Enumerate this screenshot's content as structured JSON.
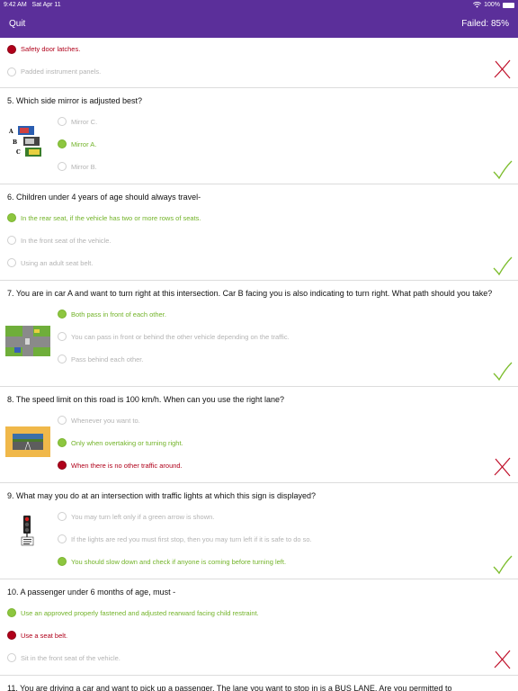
{
  "status": {
    "time": "9:42 AM",
    "date": "Sat Apr 11",
    "battery": "100%"
  },
  "nav": {
    "quit_label": "Quit",
    "result_label": "Failed: 85%"
  },
  "colors": {
    "header": "#5b2f9a",
    "correct": "#8dc63f",
    "wrong": "#b0001a"
  },
  "q4": {
    "answers": [
      "Safety door latches.",
      "Padded instrument panels."
    ]
  },
  "q5": {
    "question": "5. Which side mirror is adjusted best?",
    "answers": [
      "Mirror C.",
      "Mirror A.",
      "Mirror B."
    ],
    "image_labels": [
      "A",
      "B",
      "C"
    ]
  },
  "q6": {
    "question": "6. Children under 4 years of age should always travel-",
    "answers": [
      "In the rear seat, if the vehicle has two or more rows of seats.",
      "In the front seat of the vehicle.",
      "Using an adult seat belt."
    ]
  },
  "q7": {
    "question": "7. You are in car A and want to turn right at this intersection.  Car B facing you is also indicating to turn right.  What path should you take?",
    "answers": [
      "Both pass in front of each other.",
      "You can pass in front or behind the other vehicle depending on the traffic.",
      "Pass behind each other."
    ]
  },
  "q8": {
    "question": "8. The speed limit on this road is 100 km/h.  When can you use the right lane?",
    "answers": [
      "Whenever you want to.",
      "Only when overtaking or turning right.",
      "When there is no other traffic around."
    ]
  },
  "q9": {
    "question": "9. What may you do at an intersection with traffic lights at which this sign is displayed?",
    "answers": [
      "You may turn left only if a green arrow is shown.",
      "If the lights are red you must first stop, then you may turn left if it is safe to do so.",
      "You should slow down and check if anyone is coming before turning left."
    ]
  },
  "q10": {
    "question": "10. A passenger under 6 months of age, must -",
    "answers": [
      "Use an approved properly fastened and adjusted rearward facing child restraint.",
      "Use a seat belt.",
      "Sit in the front seat of the vehicle."
    ]
  },
  "q11": {
    "question": "11. You are driving a car and want to pick up a passenger.  The lane you want to stop in is a BUS LANE.  Are you permitted to"
  }
}
